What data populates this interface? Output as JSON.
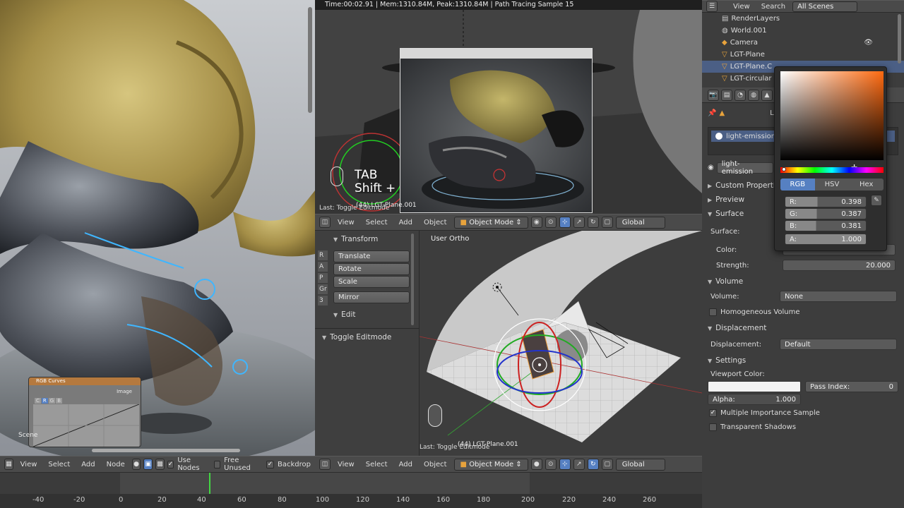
{
  "info_bar": {
    "text": "Time:00:02.91 | Mem:1310.84M, Peak:1310.84M | Path Tracing Sample 15"
  },
  "node_editor": {
    "menu": [
      "View",
      "Select",
      "Add",
      "Node"
    ],
    "use_nodes": "Use Nodes",
    "free_unused": "Free Unused",
    "backdrop": "Backdrop",
    "rgb_curves": {
      "title": "RGB Curves",
      "channels": [
        "C",
        "R",
        "G",
        "B"
      ],
      "image_label": "Image"
    },
    "scene_label": "Scene"
  },
  "render_view": {
    "key_hint": "TAB",
    "key_hint2": "Shift +",
    "last_op": "Last: Toggle Editmode",
    "object_label": "(44) LGT-Plane.001",
    "menu": [
      "View",
      "Select",
      "Add",
      "Object"
    ],
    "mode": "Object Mode",
    "orientation": "Global"
  },
  "tool_shelf": {
    "transform_title": "Transform",
    "buttons": [
      "Translate",
      "Rotate",
      "Scale"
    ],
    "mirror": "Mirror",
    "edit_title": "Edit",
    "tabs": [
      "R",
      "A",
      "P",
      "Gr",
      "3"
    ],
    "toggle_editmode": "Toggle Editmode"
  },
  "viewport": {
    "title": "User Ortho",
    "last_op": "Last: Toggle Editmode",
    "object_label": "(44) LGT-Plane.001",
    "menu": [
      "View",
      "Select",
      "Add",
      "Object"
    ],
    "mode": "Object Mode",
    "orientation": "Global"
  },
  "outliner": {
    "menu": [
      "View",
      "Search"
    ],
    "scope": "All Scenes",
    "items": [
      "RenderLayers",
      "World.001",
      "Camera",
      "LGT-Plane",
      "LGT-Plane.C",
      "LGT-circular"
    ]
  },
  "properties": {
    "breadcrumb": "LGT-P",
    "material_slot": "light-emission.00",
    "material_name": "light-emission",
    "panels": {
      "custom_properties": "Custom Properties",
      "preview": "Preview",
      "surface": "Surface",
      "volume": "Volume",
      "displacement": "Displacement",
      "settings": "Settings"
    },
    "surface_label": "Surface:",
    "color_label": "Color:",
    "strength_label": "Strength:",
    "strength_value": "20.000",
    "volume_label": "Volume:",
    "volume_value": "None",
    "homogeneous_volume": "Homogeneous Volume",
    "displacement_label": "Displacement:",
    "displacement_value": "Default",
    "viewport_color": "Viewport Color:",
    "pass_index_label": "Pass Index:",
    "pass_index_value": "0",
    "alpha_label": "Alpha:",
    "alpha_value": "1.000",
    "multiple_importance": "Multiple Importance Sample",
    "transparent_shadows": "Transparent Shadows"
  },
  "color_picker": {
    "tabs": [
      "RGB",
      "HSV",
      "Hex"
    ],
    "active_tab": "RGB",
    "r_label": "R:",
    "r": "0.398",
    "g_label": "G:",
    "g": "0.387",
    "b_label": "B:",
    "b": "0.381",
    "a_label": "A:",
    "a": "1.000",
    "hue_color": "#ff6a10"
  },
  "timeline": {
    "ticks": [
      "-40",
      "-20",
      "0",
      "20",
      "40",
      "60",
      "80",
      "100",
      "120",
      "140",
      "160",
      "180",
      "200",
      "220",
      "240",
      "260"
    ]
  },
  "colors": {
    "accent": "#5680c2",
    "header": "#4a4a4a",
    "panel": "#3d3d3d"
  }
}
